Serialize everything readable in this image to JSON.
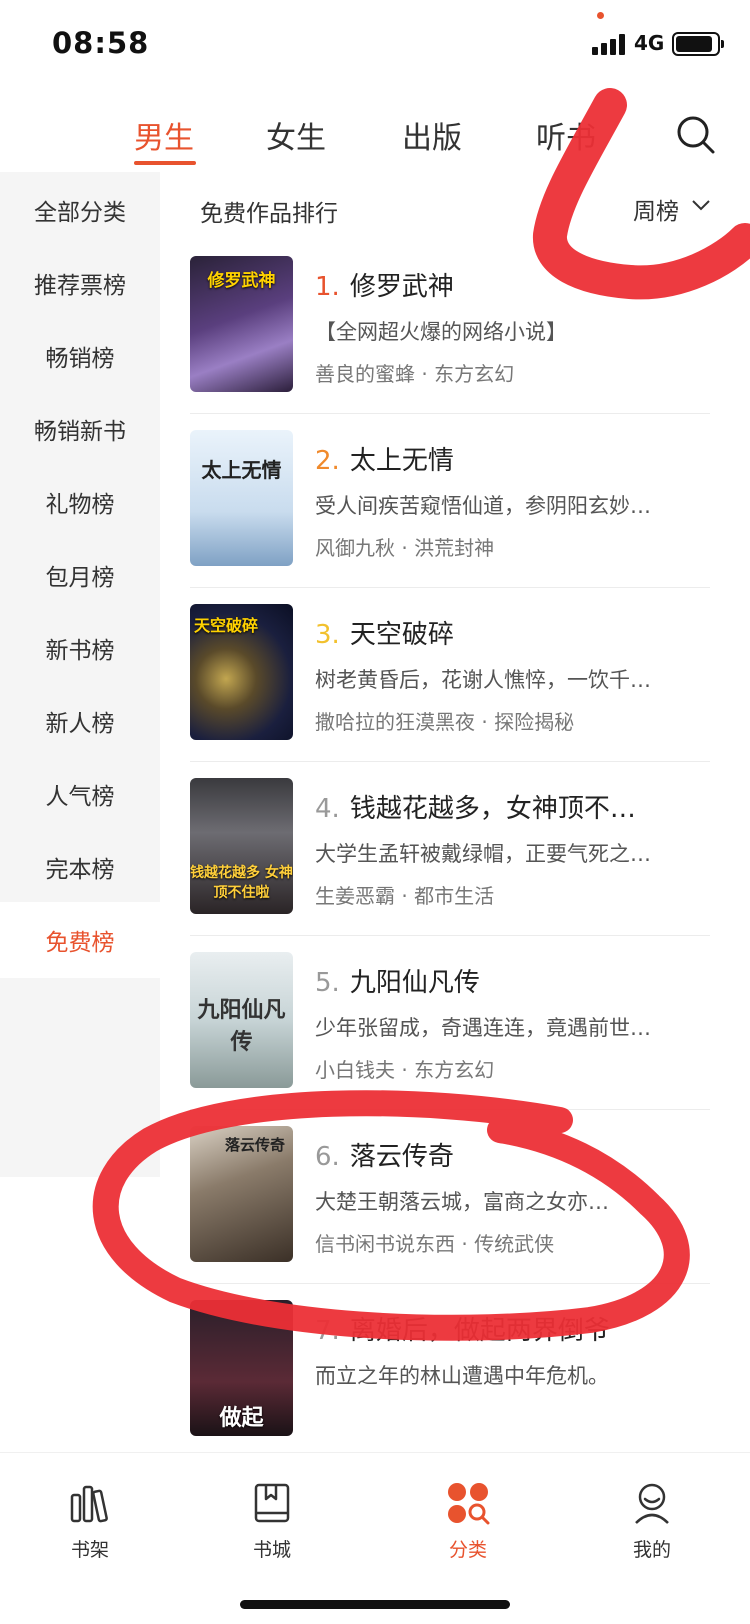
{
  "status_bar": {
    "time": "08:58",
    "network": "4G"
  },
  "top_tabs": {
    "items": [
      {
        "label": "男生",
        "active": true
      },
      {
        "label": "女生",
        "active": false
      },
      {
        "label": "出版",
        "active": false
      },
      {
        "label": "听书",
        "active": false
      }
    ]
  },
  "sidebar": {
    "items": [
      {
        "label": "全部分类"
      },
      {
        "label": "推荐票榜"
      },
      {
        "label": "畅销榜"
      },
      {
        "label": "畅销新书"
      },
      {
        "label": "礼物榜"
      },
      {
        "label": "包月榜"
      },
      {
        "label": "新书榜"
      },
      {
        "label": "新人榜"
      },
      {
        "label": "人气榜"
      },
      {
        "label": "完本榜"
      },
      {
        "label": "免费榜",
        "active": true
      }
    ]
  },
  "main": {
    "title": "免费作品排行",
    "period": "周榜",
    "books": [
      {
        "rank": "1.",
        "title": "修罗武神",
        "desc": "【全网超火爆的网络小说】",
        "author": "善良的蜜蜂",
        "genre": "东方玄幻",
        "cover_text": "修罗武神"
      },
      {
        "rank": "2.",
        "title": "太上无情",
        "desc": "受人间疾苦窥悟仙道，参阴阳玄妙…",
        "author": "风御九秋",
        "genre": "洪荒封神",
        "cover_text": "太上无情"
      },
      {
        "rank": "3.",
        "title": "天空破碎",
        "desc": "树老黄昏后，花谢人憔悴，一饮千…",
        "author": "撒哈拉的狂漠黑夜",
        "genre": "探险揭秘",
        "cover_text": "天空破碎"
      },
      {
        "rank": "4.",
        "title": "钱越花越多，女神顶不…",
        "desc": "大学生孟轩被戴绿帽，正要气死之…",
        "author": "生姜恶霸",
        "genre": "都市生活",
        "cover_text": "钱越花越多 女神顶不住啦"
      },
      {
        "rank": "5.",
        "title": "九阳仙凡传",
        "desc": "少年张留成，奇遇连连，竟遇前世…",
        "author": "小白钱夫",
        "genre": "东方玄幻",
        "cover_text": "九阳仙凡传"
      },
      {
        "rank": "6.",
        "title": "落云传奇",
        "desc": "大楚王朝落云城，富商之女亦…",
        "author": "信书闲书说东西",
        "genre": "传统武侠",
        "cover_text": "落云传奇"
      },
      {
        "rank": "7.",
        "title": "离婚后，做起两界倒爷",
        "desc": "而立之年的林山遭遇中年危机。",
        "author": "",
        "genre": "",
        "cover_text": "做起"
      }
    ],
    "separator": "·"
  },
  "bottom_nav": {
    "items": [
      {
        "label": "书架",
        "icon": "bookshelf-icon"
      },
      {
        "label": "书城",
        "icon": "bookstore-icon"
      },
      {
        "label": "分类",
        "icon": "category-icon",
        "active": true
      },
      {
        "label": "我的",
        "icon": "profile-icon"
      }
    ]
  },
  "colors": {
    "accent": "#e8532e",
    "rank1": "#e8532e",
    "rank2": "#f08a2c",
    "rank3": "#f2c12e",
    "rank_other": "#999999",
    "annotation": "#ec2f36"
  }
}
